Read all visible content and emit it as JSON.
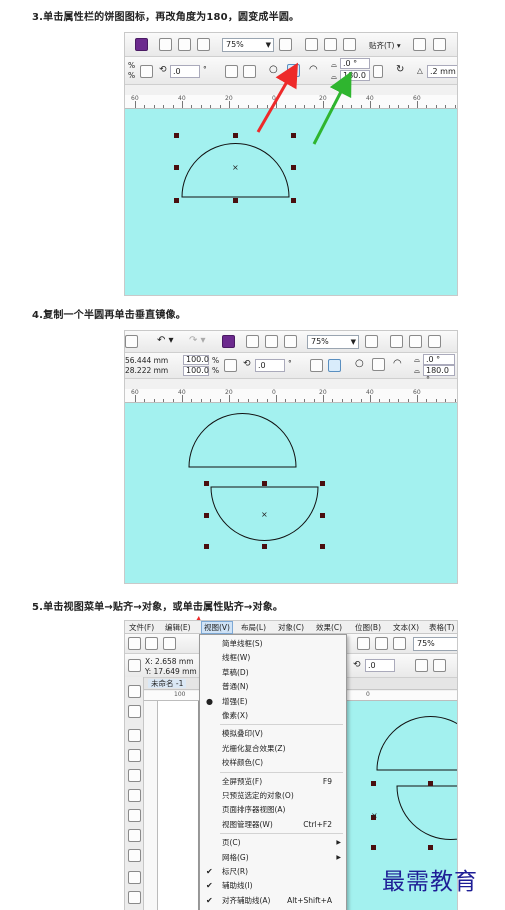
{
  "steps": [
    {
      "caption": "3.单击属性栏的饼图图标，再改角度为180，圆变成半圆。"
    },
    {
      "caption": "4.复制一个半圆再单击垂直镜像。"
    },
    {
      "caption": "5.单击视图菜单→贴齐→对象，或单击属性贴齐→对象。"
    }
  ],
  "shot1": {
    "zoom": "75%",
    "snap": "贴齐(T)",
    "rotation": ".0",
    "angle_start": ".0 °",
    "angle_end": "180.0 °",
    "outline": ".2 mm",
    "ruler": [
      "60",
      "40",
      "20",
      "0",
      "20",
      "40",
      "60"
    ],
    "pct": "%"
  },
  "shot2": {
    "zoom": "75%",
    "width": "56.444 mm",
    "height": "28.222 mm",
    "scale_x": "100.0",
    "scale_y": "100.0",
    "pct": "%",
    "rotation": ".0",
    "angle_start": ".0 °",
    "angle_end": "180.0 °",
    "ruler": [
      "60",
      "40",
      "20",
      "0",
      "20",
      "40",
      "60"
    ]
  },
  "shot3": {
    "menubar": [
      "文件(F)",
      "编辑(E)",
      "视图(V)",
      "布局(L)",
      "对象(C)",
      "效果(C)",
      "位图(B)",
      "文本(X)",
      "表格(T)"
    ],
    "zoom": "75%",
    "x_pos": "X: 2.658 mm",
    "y_pos": "Y: 17.649 mm",
    "doc_tab": "未命名 -1",
    "rotation": ".0",
    "ruler_left": "100",
    "ruler_right": "0",
    "menu": [
      {
        "label": "简单线框(S)"
      },
      {
        "label": "线框(W)"
      },
      {
        "label": "草稿(D)"
      },
      {
        "label": "普通(N)"
      },
      {
        "label": "增强(E)",
        "mark": "●"
      },
      {
        "label": "像素(X)"
      },
      {
        "label": "模拟叠印(V)"
      },
      {
        "label": "光栅化复合效果(Z)"
      },
      {
        "label": "校样颜色(C)"
      },
      {
        "label": "全屏预览(F)",
        "key": "F9"
      },
      {
        "label": "只预览选定的对象(O)"
      },
      {
        "label": "页面排序器视图(A)"
      },
      {
        "label": "视图管理器(W)",
        "key": "Ctrl+F2"
      },
      {
        "label": "页(C)",
        "sub": "▶"
      },
      {
        "label": "网格(G)",
        "sub": "▶"
      },
      {
        "label": "标尺(R)",
        "mark": "✔"
      },
      {
        "label": "辅助线(I)",
        "mark": "✔"
      },
      {
        "label": "对齐辅助线(A)",
        "key": "Alt+Shift+A",
        "mark": "✔"
      }
    ]
  },
  "watermark": "最需教育",
  "colors": {
    "canvas": "#a3f1ef",
    "arrow_red": "#ee2a2a",
    "arrow_green": "#2fb52f",
    "node": "#4a0f0f",
    "watermark": "#1e1e96"
  }
}
